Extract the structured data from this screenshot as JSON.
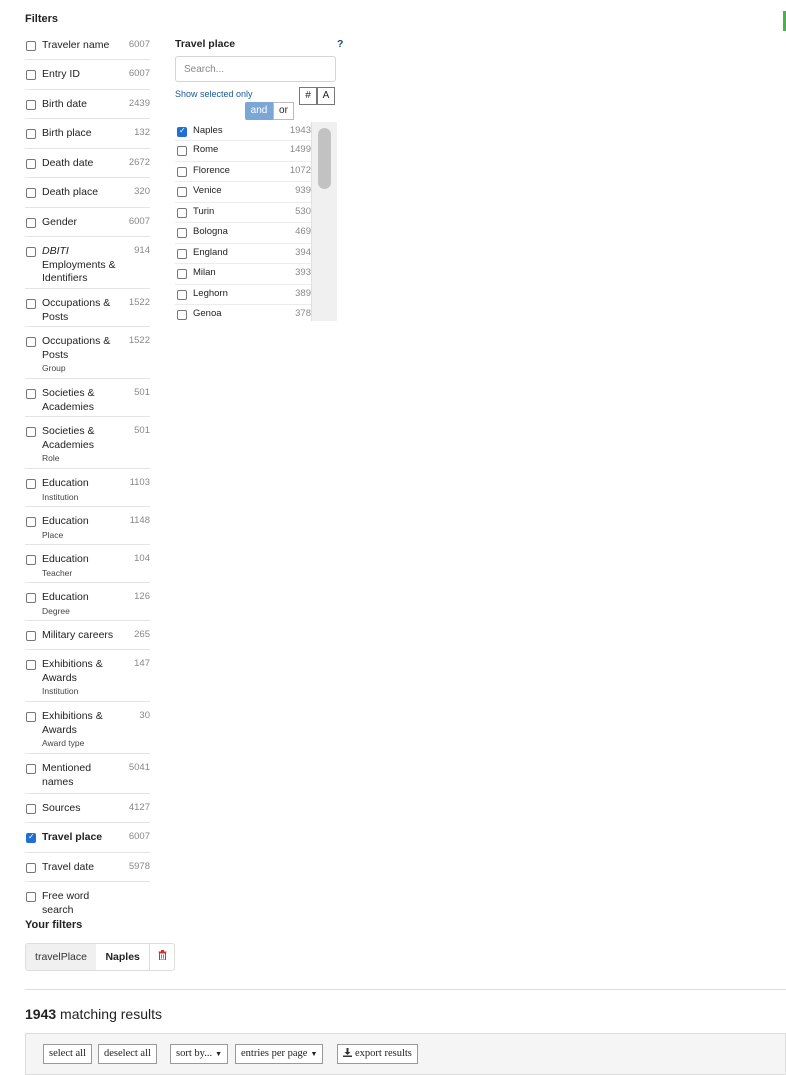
{
  "sidebar": {
    "title": "Filters",
    "items": [
      {
        "label": "Traveler name",
        "sub": "",
        "count": "6007",
        "checked": false,
        "italic": false,
        "bold": false
      },
      {
        "label": "Entry ID",
        "sub": "",
        "count": "6007",
        "checked": false,
        "italic": false,
        "bold": false
      },
      {
        "label": "Birth date",
        "sub": "",
        "count": "2439",
        "checked": false,
        "italic": false,
        "bold": false
      },
      {
        "label": "Birth place",
        "sub": "",
        "count": "132",
        "checked": false,
        "italic": false,
        "bold": false
      },
      {
        "label": "Death date",
        "sub": "",
        "count": "2672",
        "checked": false,
        "italic": false,
        "bold": false
      },
      {
        "label": "Death place",
        "sub": "",
        "count": "320",
        "checked": false,
        "italic": false,
        "bold": false
      },
      {
        "label": "Gender",
        "sub": "",
        "count": "6007",
        "checked": false,
        "italic": false,
        "bold": false
      },
      {
        "label": "DBITI",
        "label2": "Employments & Identifiers",
        "sub": "",
        "count": "914",
        "checked": false,
        "italic": true,
        "bold": false
      },
      {
        "label": "Occupations & Posts",
        "sub": "",
        "count": "1522",
        "checked": false,
        "italic": false,
        "bold": false
      },
      {
        "label": "Occupations & Posts",
        "sub": "Group",
        "count": "1522",
        "checked": false,
        "italic": false,
        "bold": false
      },
      {
        "label": "Societies & Academies",
        "sub": "",
        "count": "501",
        "checked": false,
        "italic": false,
        "bold": false
      },
      {
        "label": "Societies & Academies",
        "sub": "Role",
        "count": "501",
        "checked": false,
        "italic": false,
        "bold": false
      },
      {
        "label": "Education",
        "sub": "Institution",
        "count": "1103",
        "checked": false,
        "italic": false,
        "bold": false
      },
      {
        "label": "Education",
        "sub": "Place",
        "count": "1148",
        "checked": false,
        "italic": false,
        "bold": false
      },
      {
        "label": "Education",
        "sub": "Teacher",
        "count": "104",
        "checked": false,
        "italic": false,
        "bold": false
      },
      {
        "label": "Education",
        "sub": "Degree",
        "count": "126",
        "checked": false,
        "italic": false,
        "bold": false
      },
      {
        "label": "Military careers",
        "sub": "",
        "count": "265",
        "checked": false,
        "italic": false,
        "bold": false
      },
      {
        "label": "Exhibitions & Awards",
        "sub": "Institution",
        "count": "147",
        "checked": false,
        "italic": false,
        "bold": false
      },
      {
        "label": "Exhibitions & Awards",
        "sub": "Award type",
        "count": "30",
        "checked": false,
        "italic": false,
        "bold": false
      },
      {
        "label": "Mentioned names",
        "sub": "",
        "count": "5041",
        "checked": false,
        "italic": false,
        "bold": false
      },
      {
        "label": "Sources",
        "sub": "",
        "count": "4127",
        "checked": false,
        "italic": false,
        "bold": false
      },
      {
        "label": "Travel place",
        "sub": "",
        "count": "6007",
        "checked": true,
        "italic": false,
        "bold": true
      },
      {
        "label": "Travel date",
        "sub": "",
        "count": "5978",
        "checked": false,
        "italic": false,
        "bold": false
      },
      {
        "label": "Free word search",
        "sub": "",
        "count": "",
        "checked": false,
        "italic": false,
        "bold": false
      }
    ]
  },
  "travel_place": {
    "title": "Travel place",
    "help": "?",
    "search_placeholder": "Search...",
    "show_selected": "Show selected only",
    "sort_numeric": "#",
    "sort_alpha": "A",
    "op_and": "and",
    "op_or": "or",
    "places": [
      {
        "name": "Naples",
        "count": "1943",
        "checked": true
      },
      {
        "name": "Rome",
        "count": "1499",
        "checked": false
      },
      {
        "name": "Florence",
        "count": "1072",
        "checked": false
      },
      {
        "name": "Venice",
        "count": "939",
        "checked": false
      },
      {
        "name": "Turin",
        "count": "530",
        "checked": false
      },
      {
        "name": "Bologna",
        "count": "469",
        "checked": false
      },
      {
        "name": "England",
        "count": "394",
        "checked": false
      },
      {
        "name": "Milan",
        "count": "393",
        "checked": false
      },
      {
        "name": "Leghorn",
        "count": "389",
        "checked": false
      },
      {
        "name": "Genoa",
        "count": "378",
        "checked": false
      }
    ]
  },
  "your_filters": {
    "title": "Your filters",
    "chip_key": "travelPlace",
    "chip_value": "Naples",
    "delete_icon": "trash-icon"
  },
  "results": {
    "count": "1943",
    "label": "matching results"
  },
  "toolbar": {
    "select_all": "select all",
    "deselect_all": "deselect all",
    "sort_by": "sort by...",
    "entries_per_page": "entries per page",
    "export_results": "export results",
    "export_icon": "download-icon"
  },
  "colors": {
    "accent_blue": "#1f6fd4",
    "and_button": "#7aa7d6",
    "link_blue": "#1a5aa0",
    "delete_red": "#cc3333",
    "status_green": "#4caf50"
  }
}
